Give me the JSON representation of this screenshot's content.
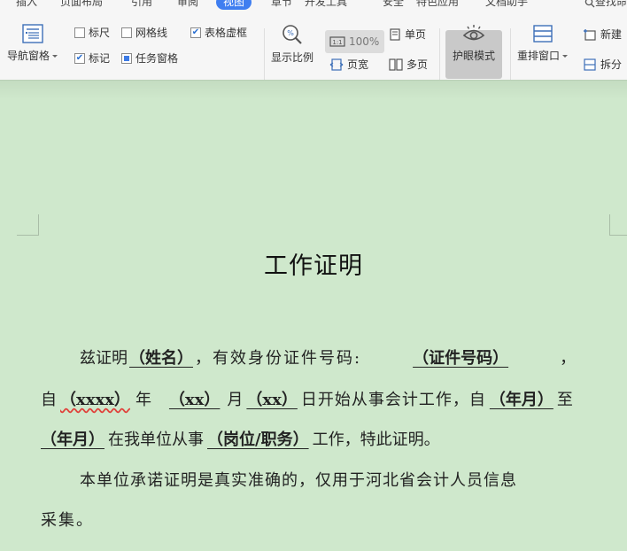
{
  "tabs": [
    "插入",
    "页面布局",
    "引用",
    "审阅",
    "视图",
    "章节",
    "开发工具",
    "安全",
    "特色应用",
    "文档助手",
    "查找命令"
  ],
  "active_tab": "视图",
  "ribbon": {
    "nav_pane": "导航窗格",
    "ruler": "标尺",
    "gridlines": "网格线",
    "table_dash": "表格虚框",
    "markup": "标记",
    "task_pane": "任务窗格",
    "zoom_ratio": "显示比例",
    "zoom_value": "100%",
    "page_width": "页宽",
    "single_page": "单页",
    "multi_page": "多页",
    "eye_mode": "护眼模式",
    "arrange_window": "重排窗口",
    "new_window": "新建",
    "split": "拆分"
  },
  "checkbox_state": {
    "ruler": false,
    "gridlines": false,
    "table_dash": true,
    "markup": true,
    "task_pane": true
  },
  "colors": {
    "page_bg": "#cfe8cc",
    "active_tab": "#3f7ef0",
    "ribbon": "#f6f6f6"
  },
  "document": {
    "title": "工作证明",
    "p1_a": "兹证明",
    "p1_name": "（姓名）",
    "p1_b": "，有效身份证件号码:",
    "p1_id": "（证件号码）",
    "p1_c": "，",
    "p2_a": "自",
    "p2_year": "（xxxx）",
    "p2_b": "年",
    "p2_month": "（xx）",
    "p2_c": "月",
    "p2_day": "（xx）",
    "p2_d": "日开始从事会计工作，自",
    "p2_ym1": "（年月）",
    "p2_e": "至",
    "p3_ym2": "（年月）",
    "p3_a": "在我单位从事",
    "p3_pos": "（岗位/职务）",
    "p3_b": "工作，特此证明。",
    "p4": "本单位承诺证明是真实准确的，仅用于河北省会计人员信息",
    "p5": "采集。"
  }
}
